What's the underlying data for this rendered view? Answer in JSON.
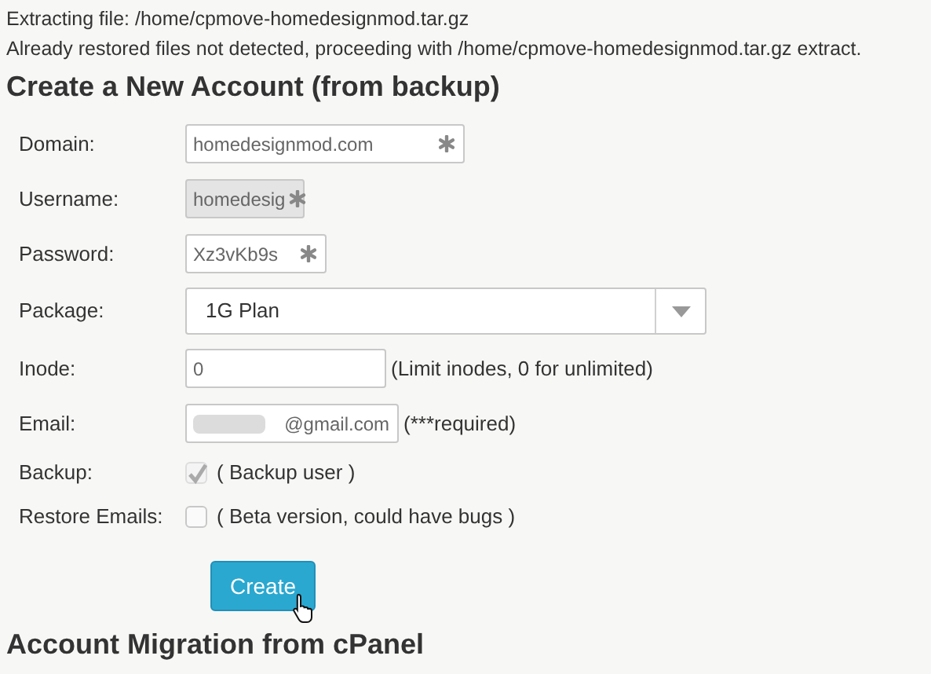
{
  "messages": [
    "Extracting file: /home/cpmove-homedesignmod.tar.gz",
    "Already restored files not detected, proceeding with /home/cpmove-homedesignmod.tar.gz extract."
  ],
  "title": "Create a New Account (from backup)",
  "fields": [
    {
      "kind": "text",
      "label": "Domain:",
      "value": "homedesignmod.com",
      "required": true,
      "disabled": false
    },
    {
      "kind": "text",
      "label": "Username:",
      "value": "homedesig",
      "required": true,
      "disabled": true
    },
    {
      "kind": "text",
      "label": "Password:",
      "value": "Xz3vKb9s",
      "required": true,
      "disabled": false
    },
    {
      "kind": "select",
      "label": "Package:",
      "value": "1G Plan"
    },
    {
      "kind": "text",
      "label": "Inode:",
      "value": "0",
      "required": false,
      "disabled": false,
      "note": "(Limit inodes, 0 for unlimited)"
    },
    {
      "kind": "text",
      "label": "Email:",
      "value": "@gmail.com",
      "required": false,
      "disabled": false,
      "redacted": true,
      "note": "(***required)"
    },
    {
      "kind": "checkbox",
      "label": "Backup:",
      "checked": true,
      "disabled": true,
      "note": "( Backup user )"
    },
    {
      "kind": "checkbox",
      "label": "Restore Emails:",
      "checked": false,
      "disabled": false,
      "note": "( Beta version, could have bugs )"
    }
  ],
  "submit": "Create",
  "next_title": "Account Migration from cPanel"
}
